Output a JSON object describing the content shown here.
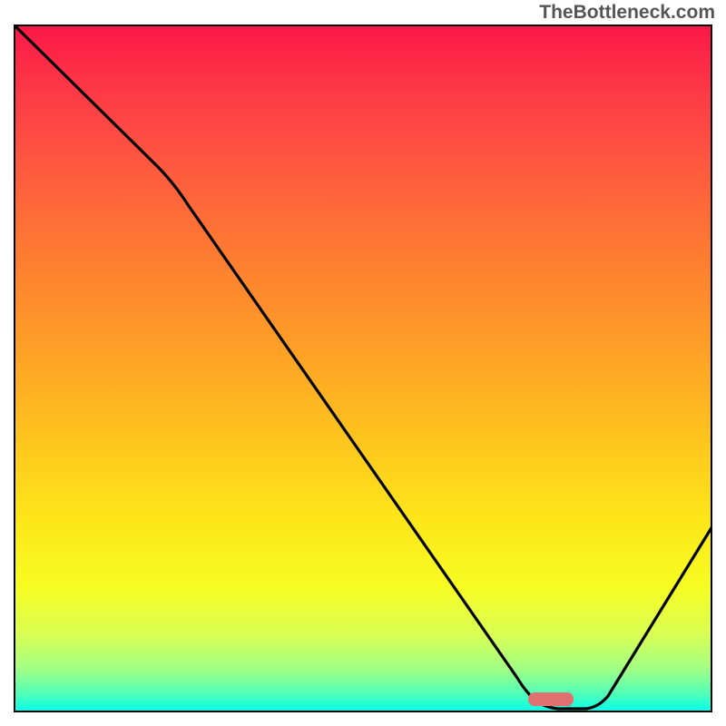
{
  "watermark": "TheBottleneck.com",
  "chart_data": {
    "type": "line",
    "title": "",
    "xlabel": "",
    "ylabel": "",
    "xlim": [
      0,
      100
    ],
    "ylim": [
      0,
      100
    ],
    "series": [
      {
        "name": "curve",
        "x": [
          0,
          20,
          25,
          72,
          78,
          82,
          100
        ],
        "y": [
          100,
          80,
          77,
          5,
          0,
          0,
          27
        ]
      }
    ],
    "marker": {
      "x_center": 77,
      "y_center": 0,
      "width": 6.5,
      "height": 2
    },
    "gradient_stops": [
      {
        "pos": 0,
        "color": "#fc1847"
      },
      {
        "pos": 10,
        "color": "#fd3b46"
      },
      {
        "pos": 22,
        "color": "#fe5d3e"
      },
      {
        "pos": 35,
        "color": "#fe8030"
      },
      {
        "pos": 48,
        "color": "#fea226"
      },
      {
        "pos": 60,
        "color": "#fec41e"
      },
      {
        "pos": 72,
        "color": "#fde61a"
      },
      {
        "pos": 82,
        "color": "#f7fd23"
      },
      {
        "pos": 89,
        "color": "#d8ff55"
      },
      {
        "pos": 94,
        "color": "#a0ff86"
      },
      {
        "pos": 97.5,
        "color": "#52ffb8"
      },
      {
        "pos": 100,
        "color": "#09ffe9"
      }
    ]
  }
}
